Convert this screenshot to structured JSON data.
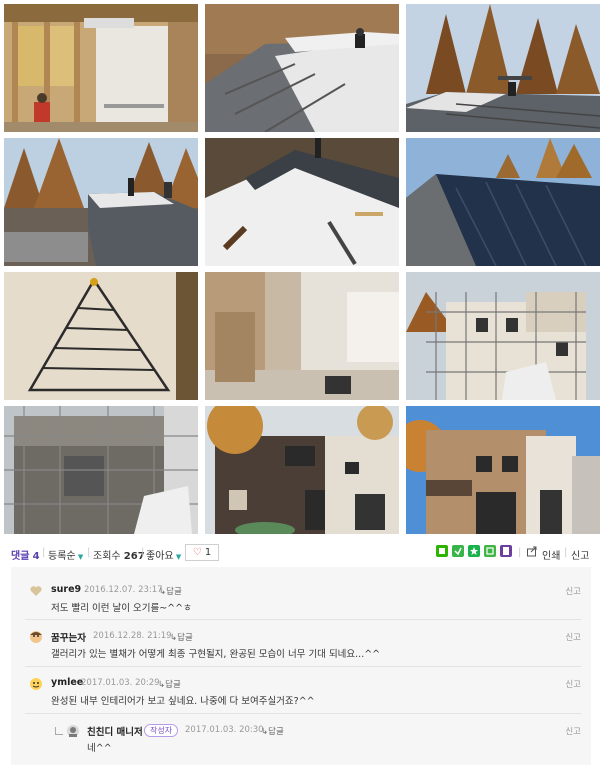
{
  "photos": [
    {
      "name": "photo-interior-framing"
    },
    {
      "name": "photo-roof-installation"
    },
    {
      "name": "photo-roof-workers-trees"
    },
    {
      "name": "photo-roof-workers-pines"
    },
    {
      "name": "photo-roof-membrane"
    },
    {
      "name": "photo-finished-roof"
    },
    {
      "name": "photo-tree-light-wall"
    },
    {
      "name": "photo-interior-room"
    },
    {
      "name": "photo-scaffolding-exterior"
    },
    {
      "name": "photo-brick-scaffolding"
    },
    {
      "name": "photo-house-autumn"
    },
    {
      "name": "photo-house-finished"
    }
  ],
  "toolbar": {
    "comments_label": "댓글",
    "comments_count": "4",
    "sort_label": "등록순",
    "views_label": "조회수",
    "views_count": "267",
    "likes_label": "좋아요",
    "like_count": "1",
    "print_label": "인쇄",
    "report_label": "신고",
    "share_icons": [
      {
        "name": "share-green-icon",
        "color": "#2db400"
      },
      {
        "name": "share-band-icon",
        "color": "#38b54a"
      },
      {
        "name": "share-star-icon",
        "color": "#19b24b"
      },
      {
        "name": "share-blog-icon",
        "color": "#3fb543"
      },
      {
        "name": "share-memo-icon",
        "color": "#6b3fa0"
      }
    ]
  },
  "comments": [
    {
      "author": "sure9",
      "date": "2016.12.07. 23:17",
      "reply_label": "답글",
      "text": "저도 빨리 이런 날이 오기를~^^ㅎ",
      "report_label": "신고"
    },
    {
      "author": "꿈꾸는자",
      "date": "2016.12.28. 21:19",
      "reply_label": "답글",
      "text": "갤러리가 있는 별채가 어떻게 최종 구현될지, 완공된 모습이 너무 기대 되네요...^^",
      "report_label": "신고"
    },
    {
      "author": "ymlee",
      "date": "2017.01.03. 20:29",
      "reply_label": "답글",
      "text": "완성된 내부 인테리어가 보고 싶네요. 나중에 다 보여주실거죠?^^",
      "report_label": "신고"
    },
    {
      "author": "친친디 매니저",
      "badge": "작성자",
      "date": "2017.01.03. 20:30",
      "reply_label": "답글",
      "text": "네^^",
      "report_label": "신고"
    }
  ]
}
